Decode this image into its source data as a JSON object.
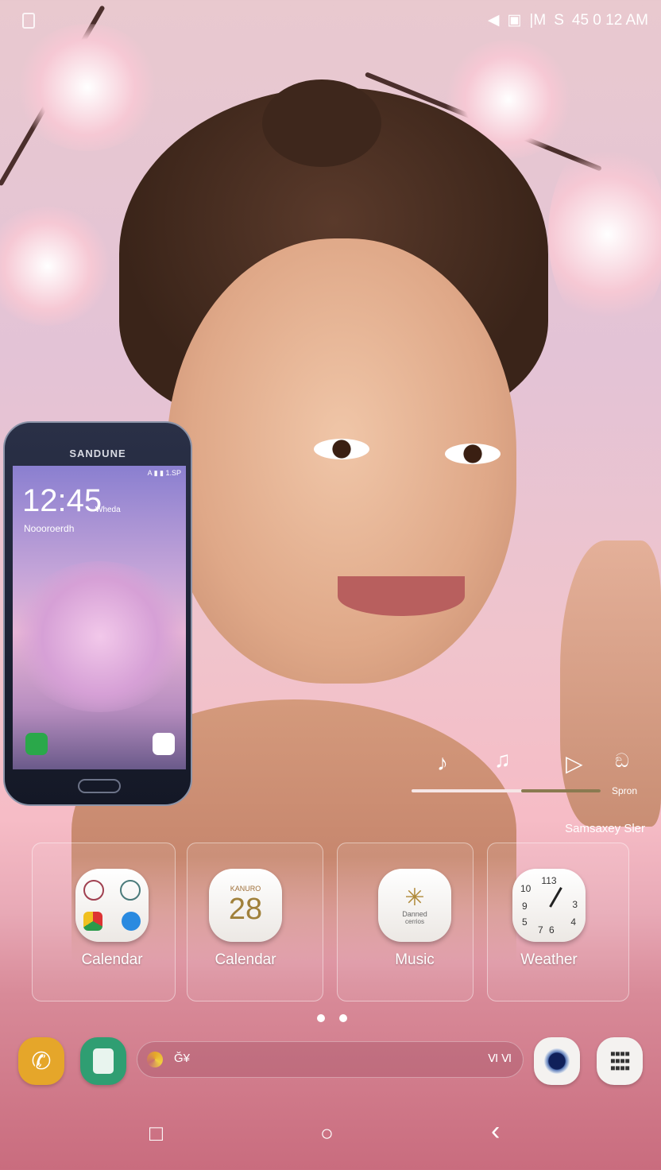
{
  "status_bar": {
    "time": "45 0 12 AM",
    "icons": [
      "notification-icon",
      "image-icon",
      "signal-icon",
      "sync-icon"
    ]
  },
  "phone_promo": {
    "brand": "SANDUNE",
    "screen_time": "12:45",
    "screen_day": "Wheda",
    "screen_date": "Noooroerdh",
    "screen_status": "A ▮ ▮ 1.SP"
  },
  "media_widget": {
    "controls": [
      "music-note-icon",
      "music-notes-icon",
      "play-icon",
      "bug-icon"
    ],
    "action_label": "Spron",
    "progress": 0.58,
    "caption": "Samsaxey Sler"
  },
  "apps": [
    {
      "label": "Calendar",
      "icon": "folder-icon"
    },
    {
      "label": "Calendar",
      "icon": "calendar-icon",
      "month": "KANURO",
      "day": "28"
    },
    {
      "label": "Music",
      "icon": "music-icon",
      "text1": "Danned",
      "text2": "cerrios"
    },
    {
      "label": "Weather",
      "icon": "clock-icon",
      "numbers": [
        "113",
        "10",
        "9",
        "5",
        "6",
        "7",
        "3",
        "4"
      ]
    }
  ],
  "page_indicator": {
    "count": 2,
    "active": 0
  },
  "dock": {
    "phone": "phone-icon",
    "messages": "messages-icon",
    "search_hint": "Ğ¥",
    "search_right": "Ⅵ Ⅵ",
    "camera": "camera-icon",
    "apps": "apps-grid-icon"
  },
  "nav": {
    "recent": "□",
    "home": "○",
    "back": "‹"
  },
  "colors": {
    "dock_phone": "#e5a62a",
    "dock_messages": "#2f9e72",
    "accent": "#c96c7e"
  }
}
